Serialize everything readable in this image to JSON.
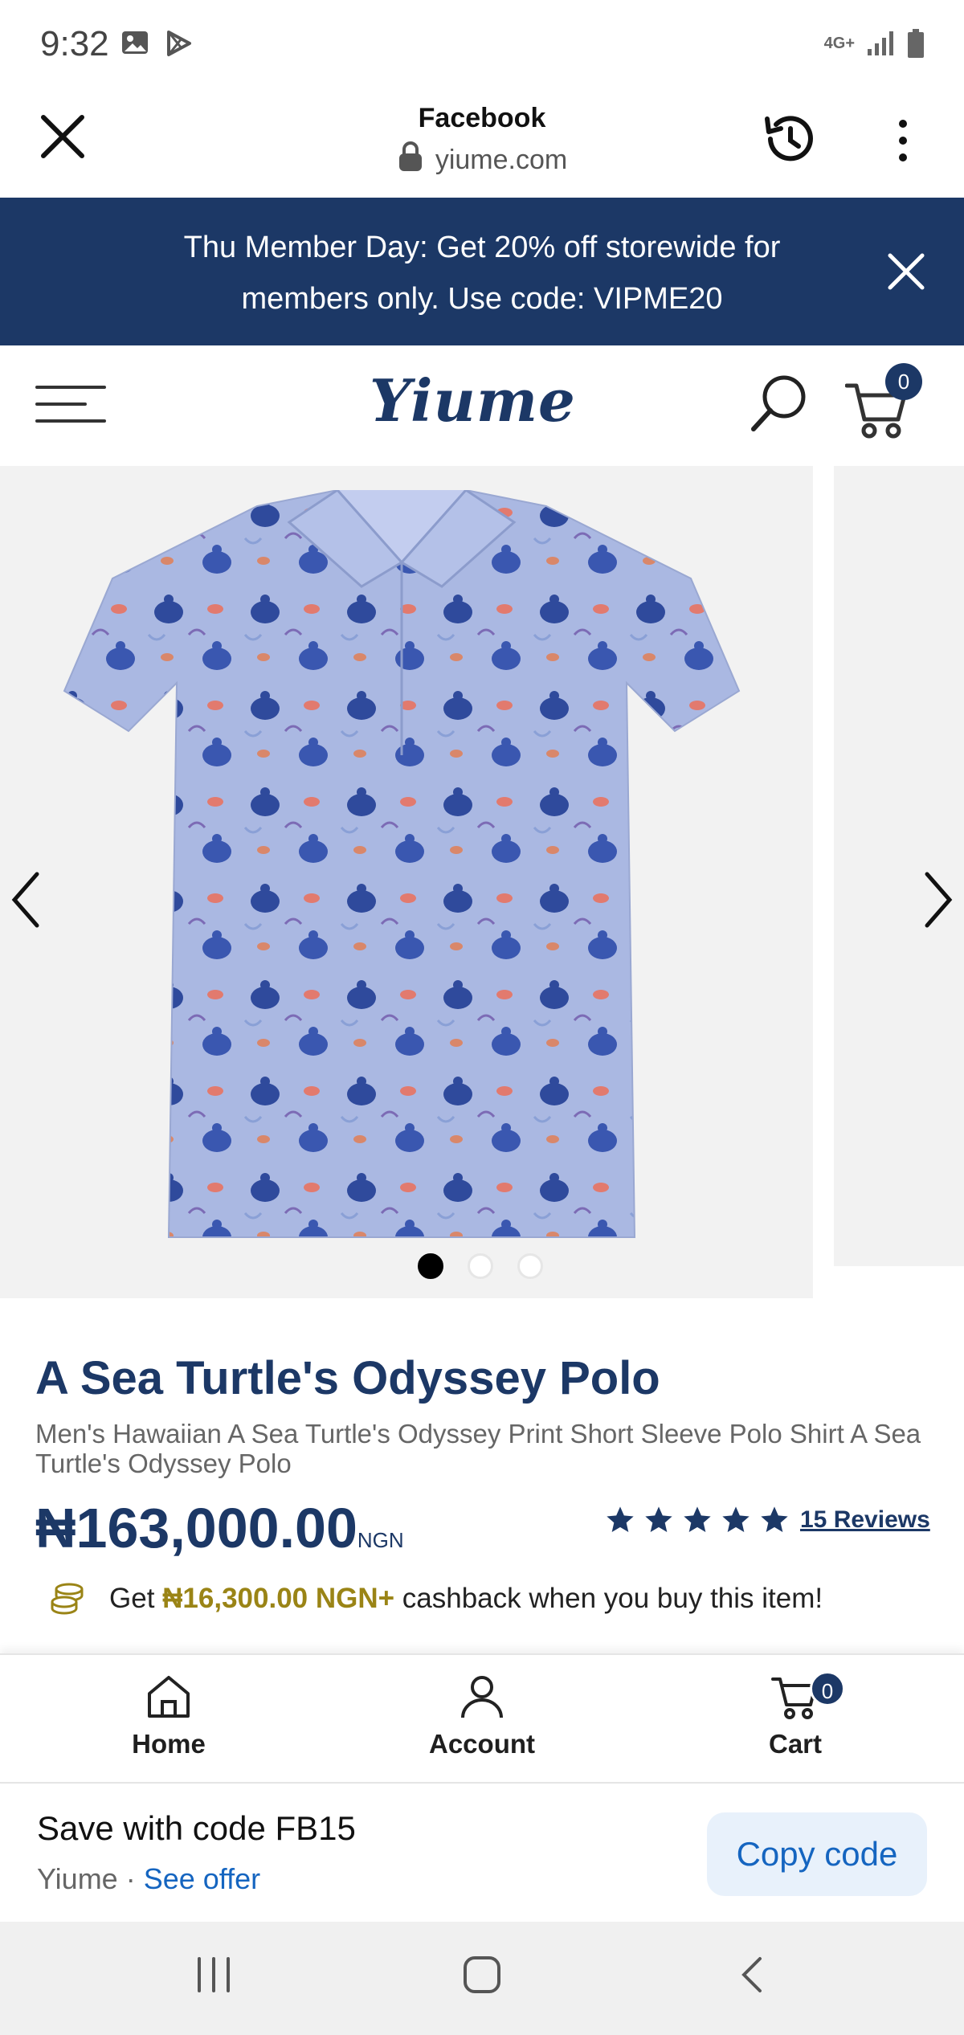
{
  "status_bar": {
    "time": "9:32",
    "network": "4G+",
    "icons_left": [
      "gallery-icon",
      "play-store-icon"
    ],
    "icons_right": [
      "network-4g-icon",
      "signal-icon",
      "battery-icon"
    ]
  },
  "browser": {
    "title": "Facebook",
    "url": "yiume.com",
    "icons": [
      "close-icon",
      "lock-icon",
      "history-icon",
      "more-vert-icon"
    ]
  },
  "promo": {
    "text": "Thu Member Day: Get 20% off storewide for members only. Use code: VIPME20",
    "background": "#1c3866"
  },
  "store": {
    "logo": "Yiume",
    "cart_count": "0",
    "brand_color": "#1c3866"
  },
  "gallery": {
    "slides_count": 3,
    "active_index": 0
  },
  "product": {
    "title": "A Sea Turtle's Odyssey Polo",
    "subtitle": "Men's Hawaiian A Sea Turtle's Odyssey Print Short Sleeve Polo Shirt A Sea Turtle's Odyssey Polo",
    "price": "₦163,000.00",
    "currency": "NGN",
    "rating": 5,
    "reviews_label": "15 Reviews",
    "cashback_pre": "Get ",
    "cashback_amount": "₦16,300.00 NGN+",
    "cashback_tail": " cashback when you buy this item!"
  },
  "bottom_nav": {
    "items": [
      {
        "label": "Home",
        "icon": "home-icon"
      },
      {
        "label": "Account",
        "icon": "account-icon"
      },
      {
        "label": "Cart",
        "icon": "cart-icon"
      }
    ],
    "cart_count": "0"
  },
  "offer": {
    "title": "Save with code FB15",
    "source": "Yiume",
    "separator": " · ",
    "link": "See offer",
    "button": "Copy code"
  }
}
